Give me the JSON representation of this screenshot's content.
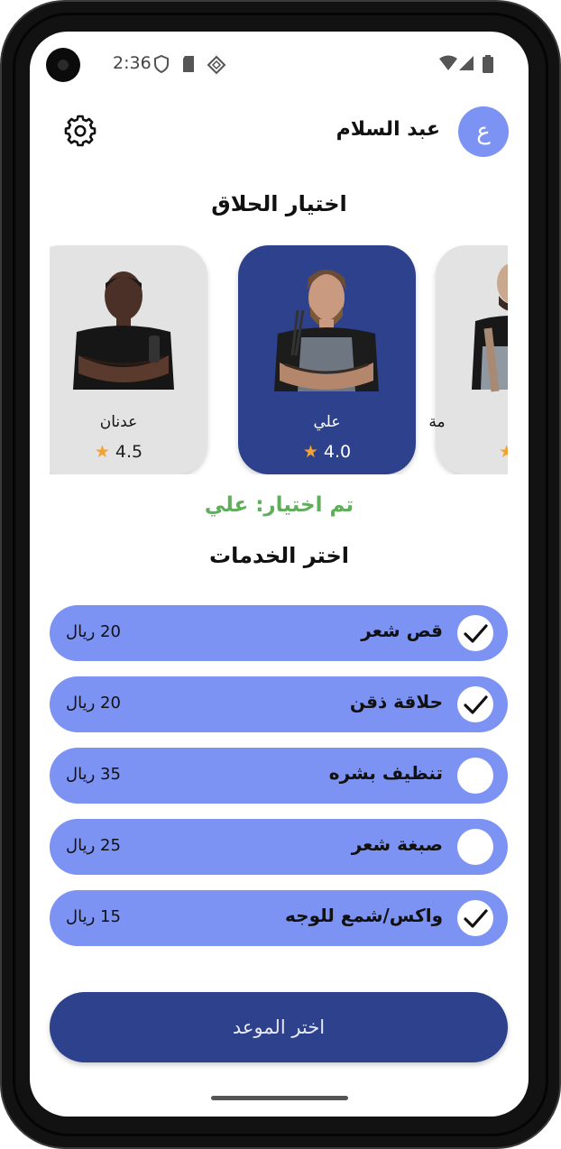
{
  "status_bar": {
    "time": "2:36"
  },
  "header": {
    "user_name": "عبد السلام",
    "avatar_initial": "ع"
  },
  "barber_section": {
    "title": "اختيار الحلاق"
  },
  "barbers": [
    {
      "name": "عدنان",
      "rating": "4.5",
      "selected": false
    },
    {
      "name": "علي",
      "rating": "4.0",
      "selected": true
    },
    {
      "name": "مة",
      "rating": "",
      "selected": false
    }
  ],
  "selection": {
    "text": "تم اختيار: علي"
  },
  "services_section": {
    "title": "اختر الخدمات"
  },
  "services": [
    {
      "name": "قص شعر",
      "price": "20 ريال",
      "checked": true
    },
    {
      "name": "حلاقة ذقن",
      "price": "20 ريال",
      "checked": true
    },
    {
      "name": "تنظيف بشره",
      "price": "35 ريال",
      "checked": false
    },
    {
      "name": "صبغة شعر",
      "price": "25 ريال",
      "checked": false
    },
    {
      "name": "واكس/شمع للوجه",
      "price": "15 ريال",
      "checked": true
    }
  ],
  "actions": {
    "choose_appointment": "اختر الموعد"
  },
  "colors": {
    "primary": "#2e418d",
    "accent": "#7d93f3",
    "success": "#5fae5a",
    "star": "#f2a230"
  }
}
